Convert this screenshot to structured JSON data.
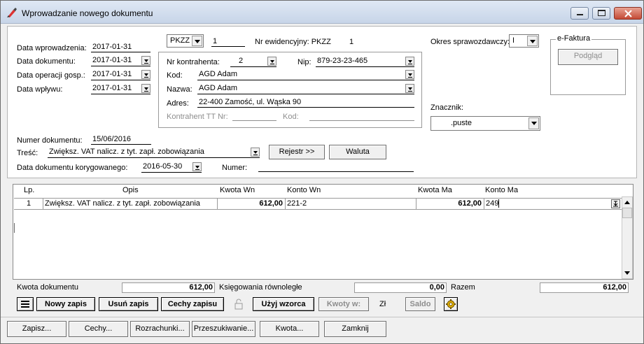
{
  "window": {
    "title": "Wprowadzanie nowego dokumentu"
  },
  "dates": {
    "wprowadzenia_label": "Data wprowadzenia:",
    "wprowadzenia": "2017-01-31",
    "dokumentu_label": "Data dokumentu:",
    "dokumentu": "2017-01-31",
    "operacji_label": "Data operacji gosp.:",
    "operacji": "2017-01-31",
    "wplywu_label": "Data wpływu:",
    "wplywu": "2017-01-31"
  },
  "doc": {
    "type": "PKZZ",
    "number": "1",
    "evid_label": "Nr ewidencyjny: PKZZ",
    "evid_number": "1",
    "period_label": "Okres sprawozdawczy:",
    "period": "I"
  },
  "contractor": {
    "nr_label": "Nr kontrahenta:",
    "nr": "2",
    "nip_label": "Nip:",
    "nip": "879-23-23-465",
    "kod_label": "Kod:",
    "kod": "AGD Adam",
    "nazwa_label": "Nazwa:",
    "nazwa": "AGD Adam",
    "adres_label": "Adres:",
    "adres": "22-400 Zamość, ul. Wąska 90",
    "tt_label": "Kontrahent TT Nr:",
    "tt_kod_label": "Kod:"
  },
  "efaktura": {
    "title": "e-Faktura",
    "preview": "Podgląd"
  },
  "znacznik": {
    "label": "Znacznik:",
    "value": ".puste"
  },
  "numer": {
    "label": "Numer dokumentu:",
    "value": "15/06/2016"
  },
  "tresc": {
    "label": "Treść:",
    "value": "Zwiększ. VAT nalicz. z tyt. zapł. zobowiązania"
  },
  "korygowany": {
    "label": "Data dokumentu korygowanego:",
    "value": "2016-05-30",
    "numer_label": "Numer:"
  },
  "buttons_mid": {
    "rejestr": "Rejestr >>",
    "waluta": "Waluta"
  },
  "table": {
    "headers": {
      "lp": "Lp.",
      "opis": "Opis",
      "kwota_wn": "Kwota Wn",
      "konto_wn": "Konto Wn",
      "kwota_ma": "Kwota Ma",
      "konto_ma": "Konto Ma"
    },
    "rows": [
      {
        "lp": "1",
        "opis": "Zwiększ. VAT nalicz. z tyt. zapł. zobowiązania",
        "kwota_wn": "612,00",
        "konto_wn": "221-2",
        "kwota_ma": "612,00",
        "konto_ma": "249"
      }
    ]
  },
  "summary": {
    "kwota_label": "Kwota dokumentu",
    "kwota": "612,00",
    "ksieg_label": "Księgowania równoległe",
    "ksieg": "0,00",
    "razem_label": "Razem",
    "razem": "612,00"
  },
  "toolbar": {
    "nowy": "Nowy zapis",
    "usun": "Usuń zapis",
    "cechy": "Cechy zapisu",
    "uzyj": "Użyj wzorca",
    "kwoty": "Kwoty w:",
    "currency": "Zł",
    "saldo": "Saldo"
  },
  "bottom": {
    "zapisz": "Zapisz...",
    "cechy": "Cechy...",
    "rozrachunki": "Rozrachunki...",
    "przeszukiwanie": "Przeszukiwanie...",
    "kwota": "Kwota...",
    "zamknij": "Zamknij"
  }
}
